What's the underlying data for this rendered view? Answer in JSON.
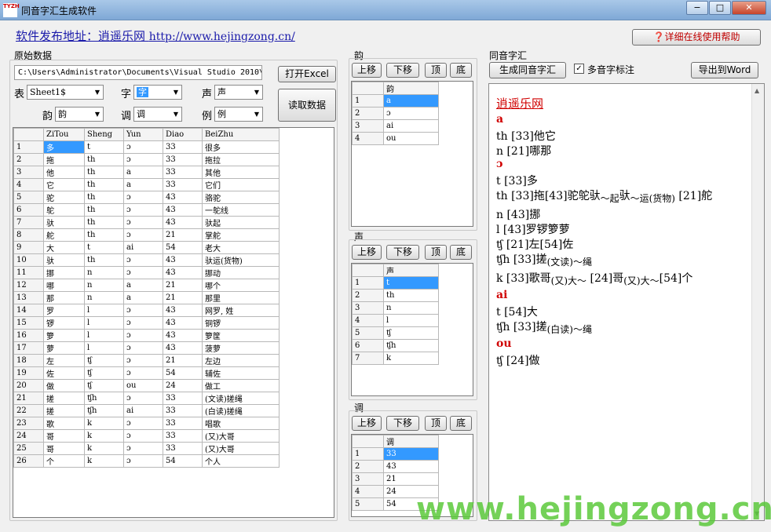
{
  "window": {
    "title": "同音字汇生成软件",
    "icon_text": "TYZH",
    "minimize": "−",
    "maximize": "□",
    "close": "✕"
  },
  "header": {
    "link_prefix": "软件发布地址：逍遥乐网 ",
    "link_url": "http://www.hejingzong.cn/",
    "help_button": "❓详细在线使用帮助"
  },
  "source": {
    "group_label": "原始数据",
    "path": "C:\\Users\\Administrator\\Documents\\Visual Studio 2010\\",
    "open_excel": "打开Excel",
    "read_data": "读取数据",
    "fields": [
      {
        "label": "表",
        "value": "Sheet1$"
      },
      {
        "label": "字",
        "value": "字"
      },
      {
        "label": "声",
        "value": "声"
      },
      {
        "label": "韵",
        "value": "韵"
      },
      {
        "label": "调",
        "value": "调"
      },
      {
        "label": "例",
        "value": "例"
      }
    ],
    "columns": [
      "ZiTou",
      "Sheng",
      "Yun",
      "Diao",
      "BeiZhu"
    ],
    "rows": [
      [
        "1",
        "多",
        "t",
        "ɔ",
        "33",
        "很多"
      ],
      [
        "2",
        "拖",
        "th",
        "ɔ",
        "33",
        "拖拉"
      ],
      [
        "3",
        "他",
        "th",
        "a",
        "33",
        "其他"
      ],
      [
        "4",
        "它",
        "th",
        "a",
        "33",
        "它们"
      ],
      [
        "5",
        "驼",
        "th",
        "ɔ",
        "43",
        "骆驼"
      ],
      [
        "6",
        "鸵",
        "th",
        "ɔ",
        "43",
        "一鸵线"
      ],
      [
        "7",
        "驮",
        "th",
        "ɔ",
        "43",
        "驮起"
      ],
      [
        "8",
        "舵",
        "th",
        "ɔ",
        "21",
        "掌舵"
      ],
      [
        "9",
        "大",
        "t",
        "ai",
        "54",
        "老大"
      ],
      [
        "10",
        "驮",
        "th",
        "ɔ",
        "43",
        "驮运(货物)"
      ],
      [
        "11",
        "挪",
        "n",
        "ɔ",
        "43",
        "挪动"
      ],
      [
        "12",
        "哪",
        "n",
        "a",
        "21",
        "哪个"
      ],
      [
        "13",
        "那",
        "n",
        "a",
        "21",
        "那里"
      ],
      [
        "14",
        "罗",
        "l",
        "ɔ",
        "43",
        "网罗, 姓"
      ],
      [
        "15",
        "锣",
        "l",
        "ɔ",
        "43",
        "铜锣"
      ],
      [
        "16",
        "箩",
        "l",
        "ɔ",
        "43",
        "箩筐"
      ],
      [
        "17",
        "萝",
        "l",
        "ɔ",
        "43",
        "菠萝"
      ],
      [
        "18",
        "左",
        "ʧ",
        "ɔ",
        "21",
        "左边"
      ],
      [
        "19",
        "佐",
        "ʧ",
        "ɔ",
        "54",
        "辅佐"
      ],
      [
        "20",
        "做",
        "ʧ",
        "ou",
        "24",
        "做工"
      ],
      [
        "21",
        "搓",
        "ʧh",
        "ɔ",
        "33",
        "(文读)搓绳"
      ],
      [
        "22",
        "搓",
        "ʧh",
        "ai",
        "33",
        "(白读)搓绳"
      ],
      [
        "23",
        "歌",
        "k",
        "ɔ",
        "33",
        "唱歌"
      ],
      [
        "24",
        "哥",
        "k",
        "ɔ",
        "33",
        "(又)大哥"
      ],
      [
        "25",
        "哥",
        "k",
        "ɔ",
        "33",
        "(又)大哥"
      ],
      [
        "26",
        "个",
        "k",
        "ɔ",
        "54",
        "个人"
      ]
    ]
  },
  "yun": {
    "label": "韵",
    "header": "韵",
    "items": [
      "a",
      "ɔ",
      "ai",
      "ou"
    ]
  },
  "sheng": {
    "label": "声",
    "header": "声",
    "items": [
      "t",
      "th",
      "n",
      "l",
      "ʧ",
      "ʧh",
      "k"
    ]
  },
  "diao": {
    "label": "调",
    "header": "调",
    "items": [
      "33",
      "43",
      "21",
      "24",
      "54"
    ]
  },
  "order_buttons": {
    "up": "上移",
    "down": "下移",
    "top": "顶",
    "bottom": "底"
  },
  "result": {
    "group_label": "同音字汇",
    "generate": "生成同音字汇",
    "polyphone_label": "多音字标注",
    "polyphone_checked": true,
    "export": "导出到Word",
    "title": "逍遥乐网",
    "lines": [
      {
        "type": "head",
        "text": "a"
      },
      {
        "type": "line",
        "text": "th  [33]他它"
      },
      {
        "type": "line",
        "text": "n  [21]哪那"
      },
      {
        "type": "head",
        "text": "ɔ"
      },
      {
        "type": "line",
        "text": "t  [33]多"
      },
      {
        "type": "rich",
        "parts": [
          {
            "t": "th  [33]拖[43]驼鸵驮"
          },
          {
            "t": "～起",
            "s": true
          },
          {
            "t": "驮"
          },
          {
            "t": "～运(货物)",
            "s": true
          },
          {
            "t": " [21]舵"
          }
        ]
      },
      {
        "type": "line",
        "text": "n  [43]挪"
      },
      {
        "type": "line",
        "text": "l  [43]罗锣箩萝"
      },
      {
        "type": "line",
        "text": "ʧ  [21]左[54]佐"
      },
      {
        "type": "rich",
        "parts": [
          {
            "t": "ʧh  [33]搓"
          },
          {
            "t": "(文读)～绳",
            "s": true
          }
        ]
      },
      {
        "type": "rich",
        "parts": [
          {
            "t": "k  [33]歌哥"
          },
          {
            "t": "(又)大～",
            "s": true
          },
          {
            "t": " [24]哥"
          },
          {
            "t": "(又)大～",
            "s": true
          },
          {
            "t": "[54]个"
          }
        ]
      },
      {
        "type": "head",
        "text": "ai"
      },
      {
        "type": "line",
        "text": "t  [54]大"
      },
      {
        "type": "rich",
        "parts": [
          {
            "t": "ʧh  [33]搓"
          },
          {
            "t": "(白读)～绳",
            "s": true
          }
        ]
      },
      {
        "type": "head",
        "text": "ou"
      },
      {
        "type": "line",
        "text": "ʧ  [24]做"
      }
    ]
  },
  "watermark": "www.hejingzong.cn"
}
